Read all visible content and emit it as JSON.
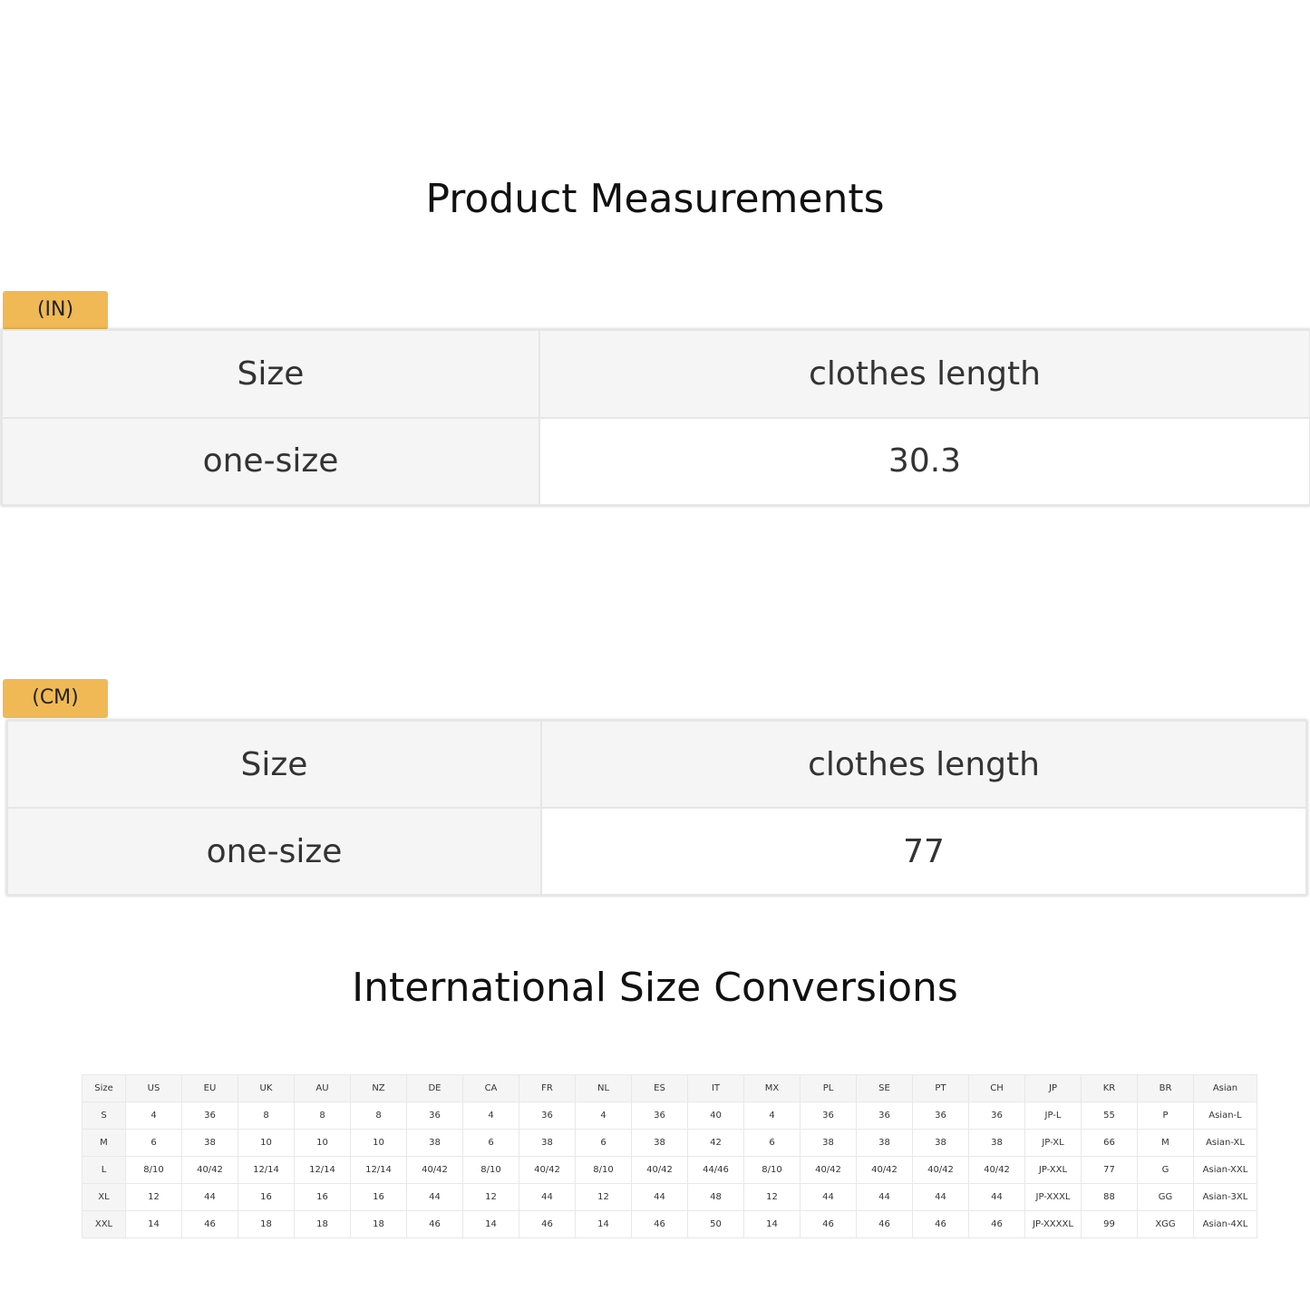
{
  "measurements": {
    "title": "Product Measurements",
    "inch": {
      "tag": "(IN)",
      "header": [
        "Size",
        "clothes length"
      ],
      "row": [
        "one-size",
        "30.3"
      ]
    },
    "cm": {
      "tag": "(CM)",
      "header": [
        "Size",
        "clothes length"
      ],
      "row": [
        "one-size",
        "77"
      ]
    }
  },
  "conversions": {
    "title": "International Size Conversions",
    "header": [
      "Size",
      "US",
      "EU",
      "UK",
      "AU",
      "NZ",
      "DE",
      "CA",
      "FR",
      "NL",
      "ES",
      "IT",
      "MX",
      "PL",
      "SE",
      "PT",
      "CH",
      "JP",
      "KR",
      "BR",
      "Asian"
    ],
    "rows": [
      [
        "S",
        "4",
        "36",
        "8",
        "8",
        "8",
        "36",
        "4",
        "36",
        "4",
        "36",
        "40",
        "4",
        "36",
        "36",
        "36",
        "36",
        "JP-L",
        "55",
        "P",
        "Asian-L"
      ],
      [
        "M",
        "6",
        "38",
        "10",
        "10",
        "10",
        "38",
        "6",
        "38",
        "6",
        "38",
        "42",
        "6",
        "38",
        "38",
        "38",
        "38",
        "JP-XL",
        "66",
        "M",
        "Asian-XL"
      ],
      [
        "L",
        "8/10",
        "40/42",
        "12/14",
        "12/14",
        "12/14",
        "40/42",
        "8/10",
        "40/42",
        "8/10",
        "40/42",
        "44/46",
        "8/10",
        "40/42",
        "40/42",
        "40/42",
        "40/42",
        "JP-XXL",
        "77",
        "G",
        "Asian-XXL"
      ],
      [
        "XL",
        "12",
        "44",
        "16",
        "16",
        "16",
        "44",
        "12",
        "44",
        "12",
        "44",
        "48",
        "12",
        "44",
        "44",
        "44",
        "44",
        "JP-XXXL",
        "88",
        "GG",
        "Asian-3XL"
      ],
      [
        "XXL",
        "14",
        "46",
        "18",
        "18",
        "18",
        "46",
        "14",
        "46",
        "14",
        "46",
        "50",
        "14",
        "46",
        "46",
        "46",
        "46",
        "JP-XXXXL",
        "99",
        "XGG",
        "Asian-4XL"
      ]
    ]
  },
  "colors": {
    "tag_background": "#f0b955",
    "header_background": "#f5f5f5",
    "border": "#e6e6e6"
  }
}
